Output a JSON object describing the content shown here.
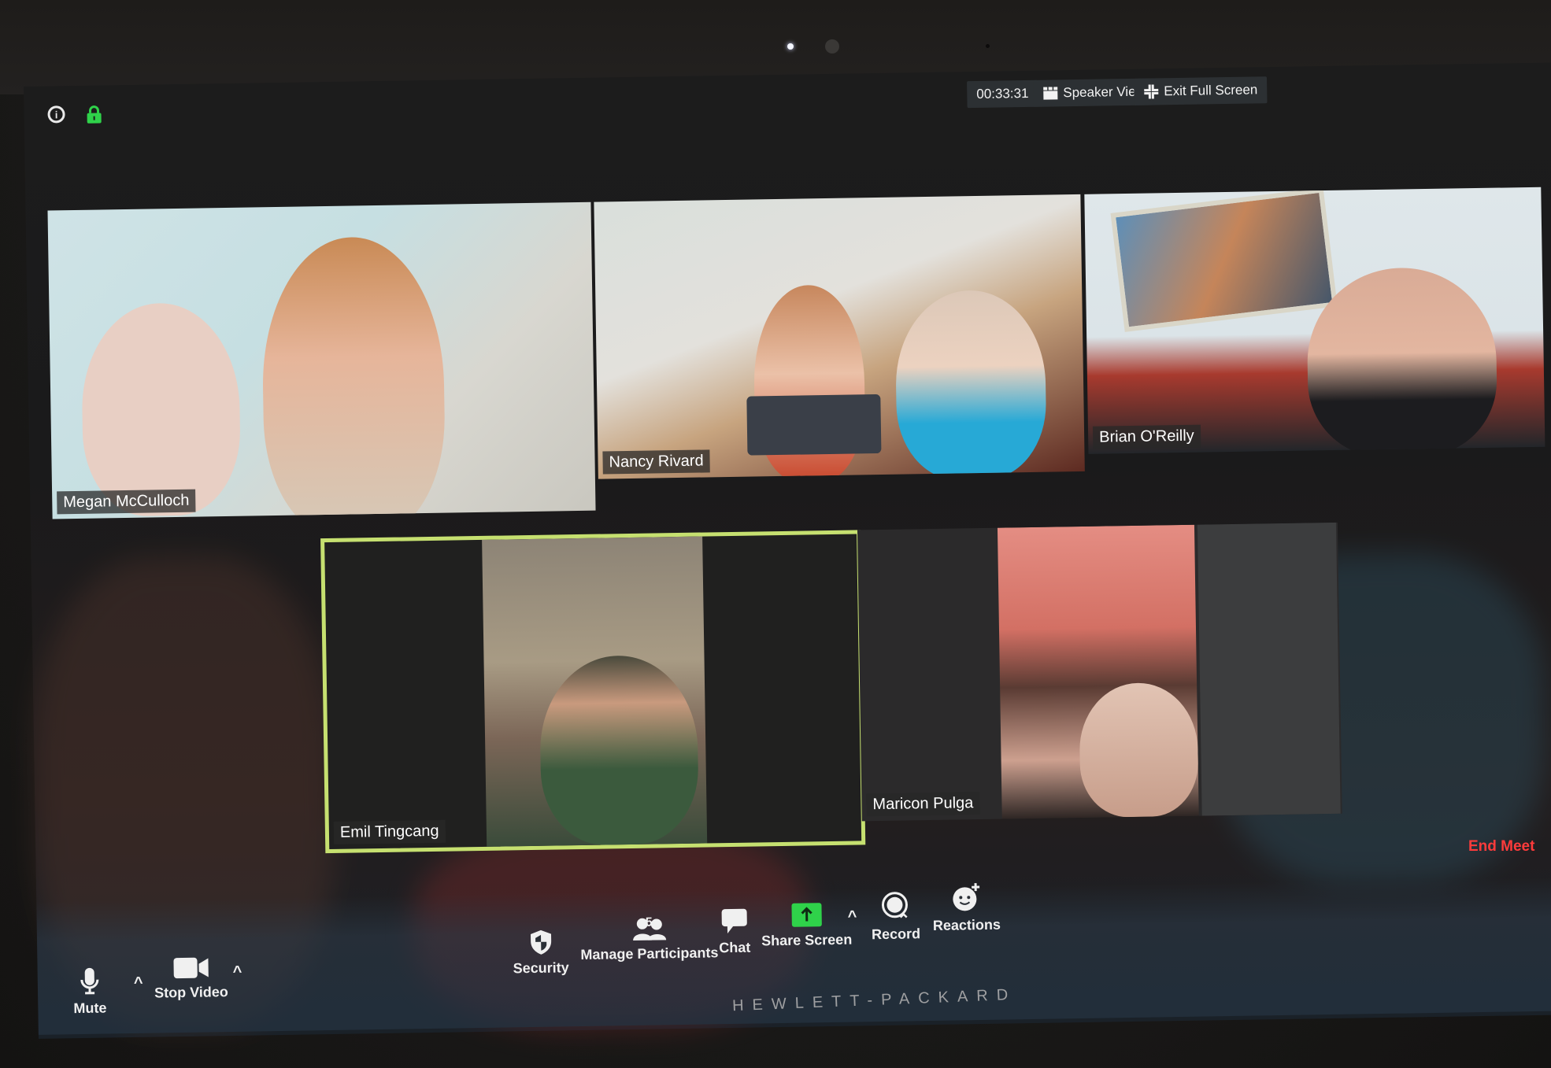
{
  "meeting": {
    "timer": "00:33:31",
    "view_mode_button": "Speaker View",
    "fullscreen_button": "Exit Full Screen",
    "info_icon": "info-icon",
    "encryption_icon": "lock-icon",
    "accent_green": "#2fd24a",
    "active_speaker_border": "#c6e070"
  },
  "participants": [
    {
      "name": "Megan McCulloch"
    },
    {
      "name": "Nancy Rivard"
    },
    {
      "name": "Brian O'Reilly"
    },
    {
      "name": "Emil Tingcang",
      "active_speaker": true
    },
    {
      "name": "Maricon Pulga"
    }
  ],
  "toolbar": {
    "mute": "Mute",
    "stop_video": "Stop Video",
    "security": "Security",
    "manage_participants": "Manage Participants",
    "participant_count": "5",
    "chat": "Chat",
    "share_screen": "Share Screen",
    "record": "Record",
    "reactions": "Reactions",
    "end_meeting": "End Meet",
    "end_color": "#ff3b3b"
  },
  "device": {
    "brand": "HEWLETT-PACKARD"
  }
}
